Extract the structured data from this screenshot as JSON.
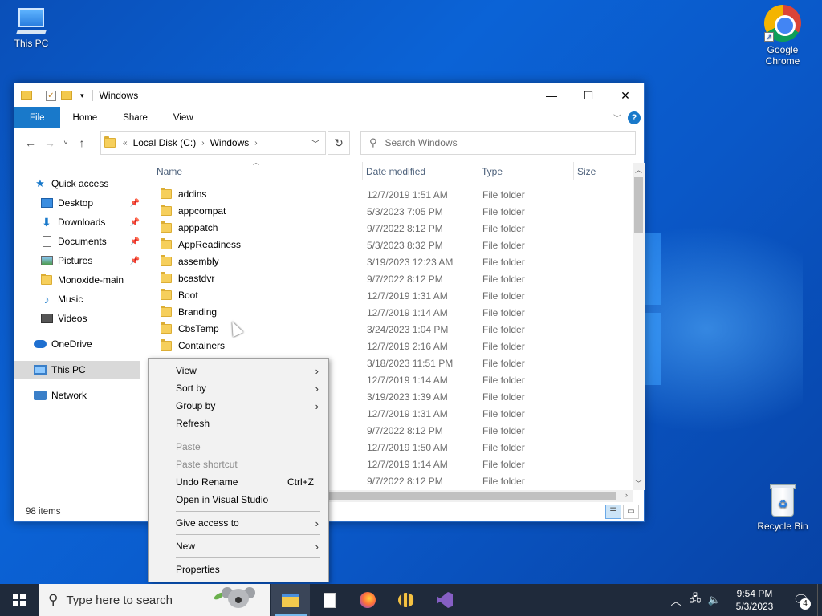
{
  "desktop": {
    "icons": [
      {
        "label": "This PC"
      },
      {
        "label": "Google Chrome"
      },
      {
        "label": "Recycle Bin"
      }
    ]
  },
  "window": {
    "title": "Windows",
    "controls": {
      "minimize": "—",
      "maximize": "☐",
      "close": "✕"
    },
    "ribbon_tabs": [
      "File",
      "Home",
      "Share",
      "View"
    ],
    "help_label": "?",
    "address": {
      "prefix": "«",
      "crumbs": [
        "Local Disk (C:)",
        "Windows"
      ]
    },
    "search_placeholder": "Search Windows",
    "columns": {
      "name": "Name",
      "date": "Date modified",
      "type": "Type",
      "size": "Size"
    },
    "status": "98 items"
  },
  "navpane": {
    "quick_access": "Quick access",
    "items": [
      "Desktop",
      "Downloads",
      "Documents",
      "Pictures",
      "Monoxide-main",
      "Music",
      "Videos"
    ],
    "onedrive": "OneDrive",
    "thispc": "This PC",
    "network": "Network"
  },
  "files": [
    {
      "name": "addins",
      "date": "12/7/2019 1:51 AM",
      "type": "File folder"
    },
    {
      "name": "appcompat",
      "date": "5/3/2023 7:05 PM",
      "type": "File folder"
    },
    {
      "name": "apppatch",
      "date": "9/7/2022 8:12 PM",
      "type": "File folder"
    },
    {
      "name": "AppReadiness",
      "date": "5/3/2023 8:32 PM",
      "type": "File folder"
    },
    {
      "name": "assembly",
      "date": "3/19/2023 12:23 AM",
      "type": "File folder"
    },
    {
      "name": "bcastdvr",
      "date": "9/7/2022 8:12 PM",
      "type": "File folder"
    },
    {
      "name": "Boot",
      "date": "12/7/2019 1:31 AM",
      "type": "File folder"
    },
    {
      "name": "Branding",
      "date": "12/7/2019 1:14 AM",
      "type": "File folder"
    },
    {
      "name": "CbsTemp",
      "date": "3/24/2023 1:04 PM",
      "type": "File folder"
    },
    {
      "name": "Containers",
      "date": "12/7/2019 2:16 AM",
      "type": "File folder"
    },
    {
      "name": "",
      "date": "3/18/2023 11:51 PM",
      "type": "File folder"
    },
    {
      "name": "",
      "date": "12/7/2019 1:14 AM",
      "type": "File folder"
    },
    {
      "name": "",
      "date": "3/19/2023 1:39 AM",
      "type": "File folder"
    },
    {
      "name": "",
      "date": "12/7/2019 1:31 AM",
      "type": "File folder"
    },
    {
      "name": "",
      "date": "9/7/2022 8:12 PM",
      "type": "File folder"
    },
    {
      "name": "",
      "date": "12/7/2019 1:50 AM",
      "type": "File folder"
    },
    {
      "name": "",
      "date": "12/7/2019 1:14 AM",
      "type": "File folder"
    },
    {
      "name": "",
      "date": "9/7/2022 8:12 PM",
      "type": "File folder"
    }
  ],
  "context_menu": {
    "view": "View",
    "sort_by": "Sort by",
    "group_by": "Group by",
    "refresh": "Refresh",
    "paste": "Paste",
    "paste_shortcut": "Paste shortcut",
    "undo_rename": "Undo Rename",
    "undo_shortcut": "Ctrl+Z",
    "open_vs": "Open in Visual Studio",
    "give_access": "Give access to",
    "new": "New",
    "properties": "Properties"
  },
  "taskbar": {
    "search_placeholder": "Type here to search",
    "time": "9:54 PM",
    "date": "5/3/2023",
    "notification_count": "4"
  }
}
